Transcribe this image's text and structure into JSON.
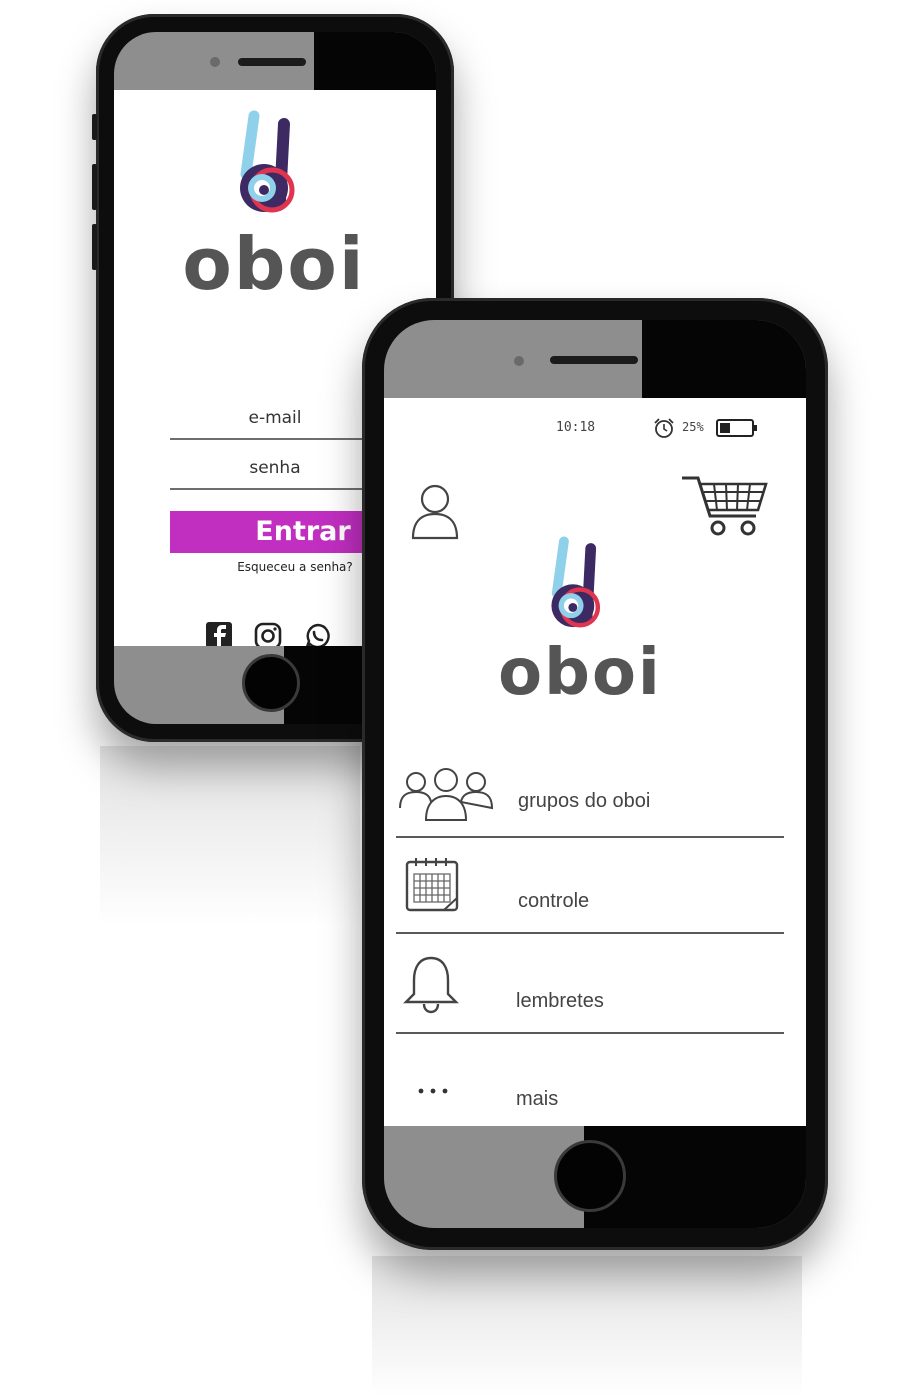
{
  "login_screen": {
    "brand": "oboi",
    "email_placeholder": "e-mail",
    "password_placeholder": "senha",
    "login_button": "Entrar",
    "forgot_password": "Esqueceu a senha?",
    "social_icons": [
      "facebook-icon",
      "instagram-icon",
      "whatsapp-icon"
    ]
  },
  "home_screen": {
    "status_bar": {
      "time": "10:18",
      "battery": "25%",
      "icons": [
        "alarm-icon",
        "battery-icon"
      ]
    },
    "brand": "oboi",
    "header_icons": [
      "profile-icon",
      "cart-icon"
    ],
    "menu": [
      {
        "label": "grupos do oboi",
        "icon": "groups-icon"
      },
      {
        "label": "controle",
        "icon": "calendar-icon"
      },
      {
        "label": "lembretes",
        "icon": "bell-icon"
      },
      {
        "label": "mais",
        "icon": "more-icon"
      }
    ]
  },
  "colors": {
    "accent": "#c02fc0",
    "logo_blue": "#8fd0ea",
    "logo_purple": "#3e2a63",
    "logo_red": "#e0354f",
    "logo_gray": "#5e5e5e"
  }
}
